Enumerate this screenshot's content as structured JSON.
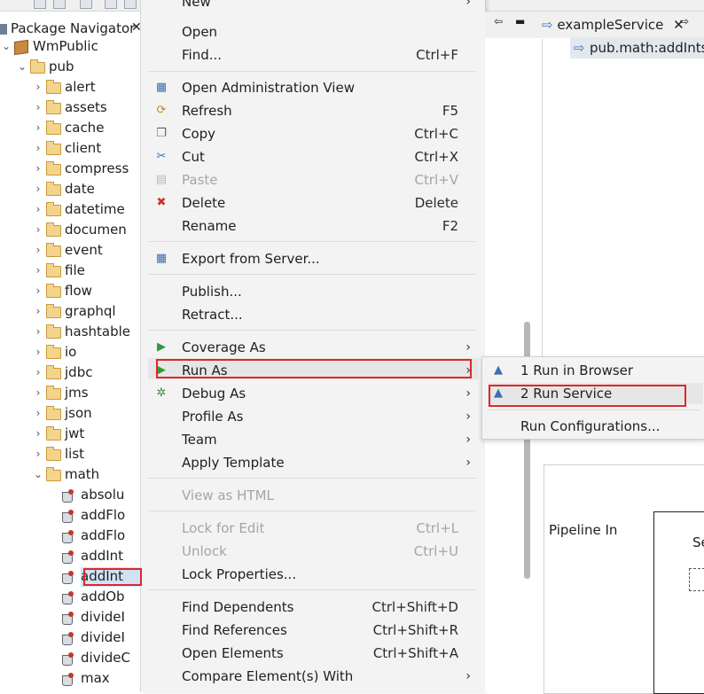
{
  "navigator": {
    "tab_title": "Package Navigator",
    "root": "WmPublic",
    "pub_folder": "pub",
    "folders": [
      "alert",
      "assets",
      "cache",
      "client",
      "compress",
      "date",
      "datetime",
      "documen",
      "event",
      "file",
      "flow",
      "graphql",
      "hashtable",
      "io",
      "jdbc",
      "jms",
      "json",
      "jwt",
      "list"
    ],
    "math_folder": "math",
    "services": [
      "absolu",
      "addFlo",
      "addFlo",
      "addInt",
      "addInt",
      "addOb",
      "divideI",
      "divideI",
      "divideC",
      "max"
    ],
    "selected_service_index": 4
  },
  "context_menu": {
    "items": [
      {
        "label": "New",
        "shortcut": "",
        "submenu": true,
        "disabled": false
      },
      {
        "label": "Open",
        "shortcut": "",
        "submenu": false,
        "disabled": false
      },
      {
        "label": "Find...",
        "shortcut": "Ctrl+F",
        "submenu": false,
        "disabled": false
      },
      {
        "label": "Open Administration View",
        "shortcut": "",
        "submenu": false,
        "disabled": false
      },
      {
        "label": "Refresh",
        "shortcut": "F5",
        "submenu": false,
        "disabled": false
      },
      {
        "label": "Copy",
        "shortcut": "Ctrl+C",
        "submenu": false,
        "disabled": false
      },
      {
        "label": "Cut",
        "shortcut": "Ctrl+X",
        "submenu": false,
        "disabled": false
      },
      {
        "label": "Paste",
        "shortcut": "Ctrl+V",
        "submenu": false,
        "disabled": true
      },
      {
        "label": "Delete",
        "shortcut": "Delete",
        "submenu": false,
        "disabled": false
      },
      {
        "label": "Rename",
        "shortcut": "F2",
        "submenu": false,
        "disabled": false
      },
      {
        "label": "Export from Server...",
        "shortcut": "",
        "submenu": false,
        "disabled": false
      },
      {
        "label": "Publish...",
        "shortcut": "",
        "submenu": false,
        "disabled": false
      },
      {
        "label": "Retract...",
        "shortcut": "",
        "submenu": false,
        "disabled": false
      },
      {
        "label": "Coverage As",
        "shortcut": "",
        "submenu": true,
        "disabled": false
      },
      {
        "label": "Run As",
        "shortcut": "",
        "submenu": true,
        "disabled": false
      },
      {
        "label": "Debug As",
        "shortcut": "",
        "submenu": true,
        "disabled": false
      },
      {
        "label": "Profile As",
        "shortcut": "",
        "submenu": true,
        "disabled": false
      },
      {
        "label": "Team",
        "shortcut": "",
        "submenu": true,
        "disabled": false
      },
      {
        "label": "Apply Template",
        "shortcut": "",
        "submenu": true,
        "disabled": false
      },
      {
        "label": "View as HTML",
        "shortcut": "",
        "submenu": false,
        "disabled": true
      },
      {
        "label": "Lock for Edit",
        "shortcut": "Ctrl+L",
        "submenu": false,
        "disabled": true
      },
      {
        "label": "Unlock",
        "shortcut": "Ctrl+U",
        "submenu": false,
        "disabled": true
      },
      {
        "label": "Lock Properties...",
        "shortcut": "",
        "submenu": false,
        "disabled": false
      },
      {
        "label": "Find Dependents",
        "shortcut": "Ctrl+Shift+D",
        "submenu": false,
        "disabled": false
      },
      {
        "label": "Find References",
        "shortcut": "Ctrl+Shift+R",
        "submenu": false,
        "disabled": false
      },
      {
        "label": "Open Elements",
        "shortcut": "Ctrl+Shift+A",
        "submenu": false,
        "disabled": false
      },
      {
        "label": "Compare Element(s) With",
        "shortcut": "",
        "submenu": true,
        "disabled": false
      }
    ],
    "highlighted_item": "Run As"
  },
  "run_as_submenu": {
    "items": [
      {
        "label": "1 Run in Browser"
      },
      {
        "label": "2 Run Service"
      },
      {
        "label": "Run Configurations..."
      }
    ]
  },
  "editor": {
    "tab_title": "exampleService",
    "breadcrumb": "pub.math:addInts",
    "pipeline_label": "Pipeline In",
    "pipeline_box_text": "Se"
  },
  "colors": {
    "highlight_border": "#e0262a",
    "selection_bg": "#d0e3f5",
    "menu_bg": "#f3f3f3"
  }
}
